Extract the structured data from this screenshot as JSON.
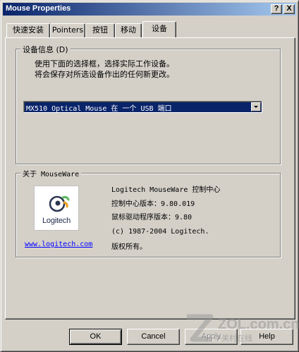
{
  "window": {
    "title": "Mouse Properties",
    "help_btn": "?",
    "close_btn": "X"
  },
  "tabs": [
    {
      "label": "快速安装"
    },
    {
      "label": "Pointers"
    },
    {
      "label": "按钮"
    },
    {
      "label": "移动"
    },
    {
      "label": "设备"
    }
  ],
  "device_group": {
    "legend": "设备信息 (D)",
    "desc1": "使用下面的选择框，选择实际工作设备。",
    "desc2": "将会保存对所选设备作出的任何新更改。",
    "selected_device": "MX510 Optical Mouse 在 一个 USB 端口"
  },
  "about_group": {
    "legend": "关于 MouseWare",
    "logo_text": "Logitech",
    "line1": "Logitech MouseWare 控制中心",
    "line2": "控制中心版本：9.80.019",
    "line3": "鼠标驱动程序版本：9.80",
    "line4": "(c) 1987-2004 Logitech.",
    "line5": "版权所有。",
    "link": "www.logitech.com"
  },
  "buttons": {
    "ok": "OK",
    "cancel": "Cancel",
    "apply": "Apply",
    "help": "Help"
  },
  "watermark": {
    "text": "ZOL.com.cn",
    "sub": "中关村在线"
  },
  "colors": {
    "titlebar_start": "#0a246a",
    "titlebar_end": "#a6caf0",
    "face": "#d4d0c8",
    "link": "#0000ff",
    "logo_green": "#5cb85c",
    "logo_orange": "#f0a020"
  }
}
